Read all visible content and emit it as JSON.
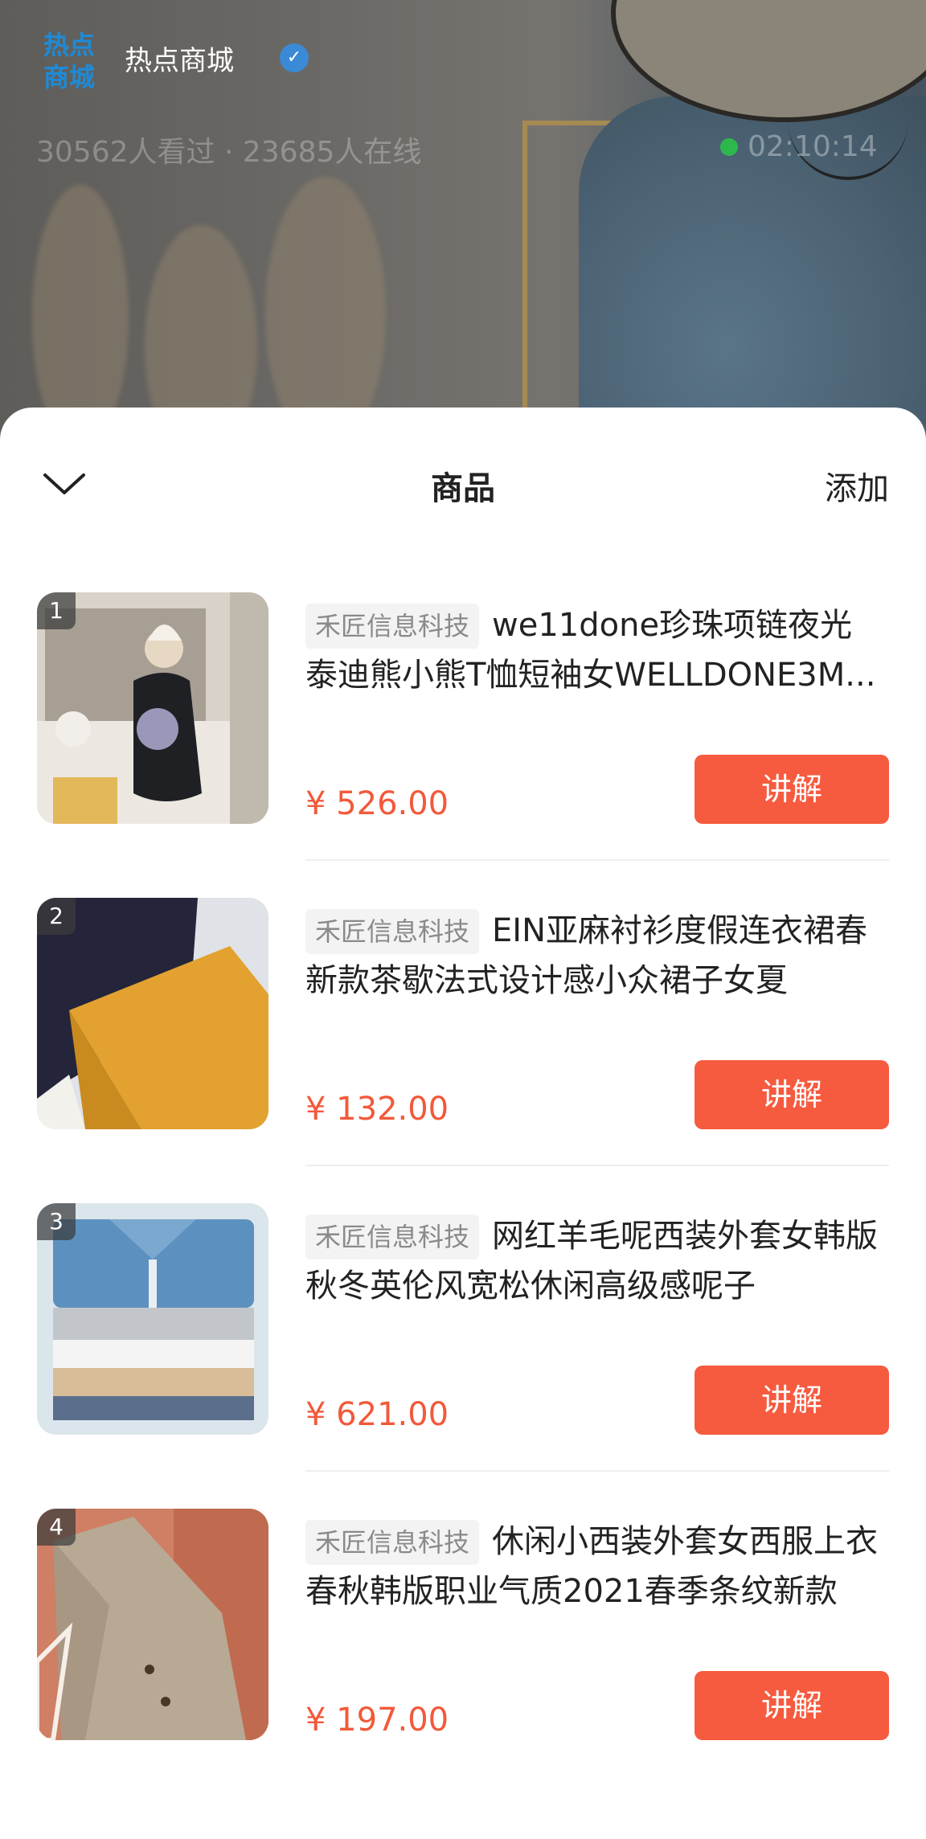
{
  "header": {
    "logo_line1": "热点",
    "logo_line2": "商城",
    "shop_name": "热点商城",
    "stats": "30562人看过 · 23685人在线",
    "live_time": "02:10:14"
  },
  "sheet": {
    "title": "商品",
    "add_label": "添加"
  },
  "products": [
    {
      "index": "1",
      "shop": "禾匠信息科技",
      "title": "we11done珍珠项链夜光泰迪熊小熊T恤短袖女WELLDONE3M...",
      "price": "¥ 526.00",
      "button": "讲解"
    },
    {
      "index": "2",
      "shop": "禾匠信息科技",
      "title": "EIN亚麻衬衫度假连衣裙春新款茶歇法式设计感小众裙子女夏",
      "price": "¥ 132.00",
      "button": "讲解"
    },
    {
      "index": "3",
      "shop": "禾匠信息科技",
      "title": "网红羊毛呢西装外套女韩版秋冬英伦风宽松休闲高级感呢子",
      "price": "¥ 621.00",
      "button": "讲解"
    },
    {
      "index": "4",
      "shop": "禾匠信息科技",
      "title": "休闲小西装外套女西服上衣春秋韩版职业气质2021春季条纹新款",
      "price": "¥ 197.00",
      "button": "讲解"
    }
  ],
  "colors": {
    "accent": "#f65b3f",
    "price": "#f2593a",
    "logo": "#1e8bd6",
    "live_dot": "#2db84d"
  },
  "icons": {
    "verified": "verified-badge-icon",
    "collapse": "chevron-down-icon"
  }
}
